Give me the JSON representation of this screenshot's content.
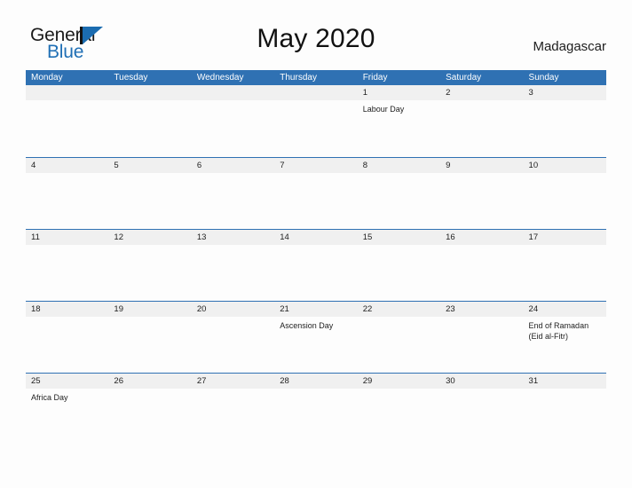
{
  "brand": {
    "name_part1": "General",
    "name_part2": "Blue",
    "mark_icon": "flag-triangle-icon",
    "accent_color": "#1b6cb0"
  },
  "header": {
    "title": "May 2020",
    "country": "Madagascar"
  },
  "colors": {
    "header_blue": "#2f71b3",
    "row_band_gray": "#f0f0f0",
    "page_background": "#fdfdfd",
    "text": "#1e1e1e"
  },
  "calendar": {
    "month": "May",
    "year": "2020",
    "weekday_headers": [
      "Monday",
      "Tuesday",
      "Wednesday",
      "Thursday",
      "Friday",
      "Saturday",
      "Sunday"
    ],
    "weeks": [
      [
        {
          "day": "",
          "events": []
        },
        {
          "day": "",
          "events": []
        },
        {
          "day": "",
          "events": []
        },
        {
          "day": "",
          "events": []
        },
        {
          "day": "1",
          "events": [
            "Labour Day"
          ]
        },
        {
          "day": "2",
          "events": []
        },
        {
          "day": "3",
          "events": []
        }
      ],
      [
        {
          "day": "4",
          "events": []
        },
        {
          "day": "5",
          "events": []
        },
        {
          "day": "6",
          "events": []
        },
        {
          "day": "7",
          "events": []
        },
        {
          "day": "8",
          "events": []
        },
        {
          "day": "9",
          "events": []
        },
        {
          "day": "10",
          "events": []
        }
      ],
      [
        {
          "day": "11",
          "events": []
        },
        {
          "day": "12",
          "events": []
        },
        {
          "day": "13",
          "events": []
        },
        {
          "day": "14",
          "events": []
        },
        {
          "day": "15",
          "events": []
        },
        {
          "day": "16",
          "events": []
        },
        {
          "day": "17",
          "events": []
        }
      ],
      [
        {
          "day": "18",
          "events": []
        },
        {
          "day": "19",
          "events": []
        },
        {
          "day": "20",
          "events": []
        },
        {
          "day": "21",
          "events": [
            "Ascension Day"
          ]
        },
        {
          "day": "22",
          "events": []
        },
        {
          "day": "23",
          "events": []
        },
        {
          "day": "24",
          "events": [
            "End of Ramadan",
            "(Eid al-Fitr)"
          ]
        }
      ],
      [
        {
          "day": "25",
          "events": [
            "Africa Day"
          ]
        },
        {
          "day": "26",
          "events": []
        },
        {
          "day": "27",
          "events": []
        },
        {
          "day": "28",
          "events": []
        },
        {
          "day": "29",
          "events": []
        },
        {
          "day": "30",
          "events": []
        },
        {
          "day": "31",
          "events": []
        }
      ]
    ]
  }
}
